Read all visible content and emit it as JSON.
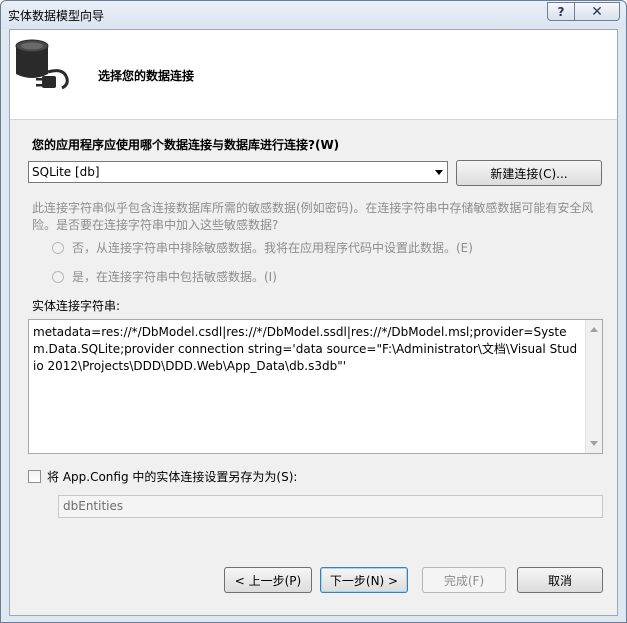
{
  "window": {
    "title": "实体数据模型向导",
    "help_label": "?",
    "close_label": "✕"
  },
  "header": {
    "title": "选择您的数据连接",
    "icon": "database-plug-icon"
  },
  "connection": {
    "question": "您的应用程序应使用哪个数据连接与数据库进行连接?(W)",
    "selected": "SQLite [db]",
    "new_connection_label": "新建连接(C)..."
  },
  "sensitive": {
    "warning": "此连接字符串似乎包含连接数据库所需的敏感数据(例如密码)。在连接字符串中存储敏感数据可能有安全风险。是否要在连接字符串中加入这些敏感数据?",
    "option_no": "否，从连接字符串中排除敏感数据。我将在应用程序代码中设置此数据。(E)",
    "option_yes": "是，在连接字符串中包括敏感数据。(I)"
  },
  "entity_connection": {
    "label": "实体连接字符串:",
    "value": "metadata=res://*/DbModel.csdl|res://*/DbModel.ssdl|res://*/DbModel.msl;provider=System.Data.SQLite;provider connection string='data source=\"F:\\Administrator\\文档\\Visual Studio 2012\\Projects\\DDD\\DDD.Web\\App_Data\\db.s3db\"'"
  },
  "save": {
    "label": "将 App.Config 中的实体连接设置另存为为(S):",
    "value": "dbEntities"
  },
  "footer": {
    "prev_label": "< 上一步(P)",
    "next_label": "下一步(N) >",
    "finish_label": "完成(F)",
    "cancel_label": "取消"
  },
  "colors": {
    "accent": "#3c7fb1",
    "disabled_text": "#8d8d8d"
  }
}
